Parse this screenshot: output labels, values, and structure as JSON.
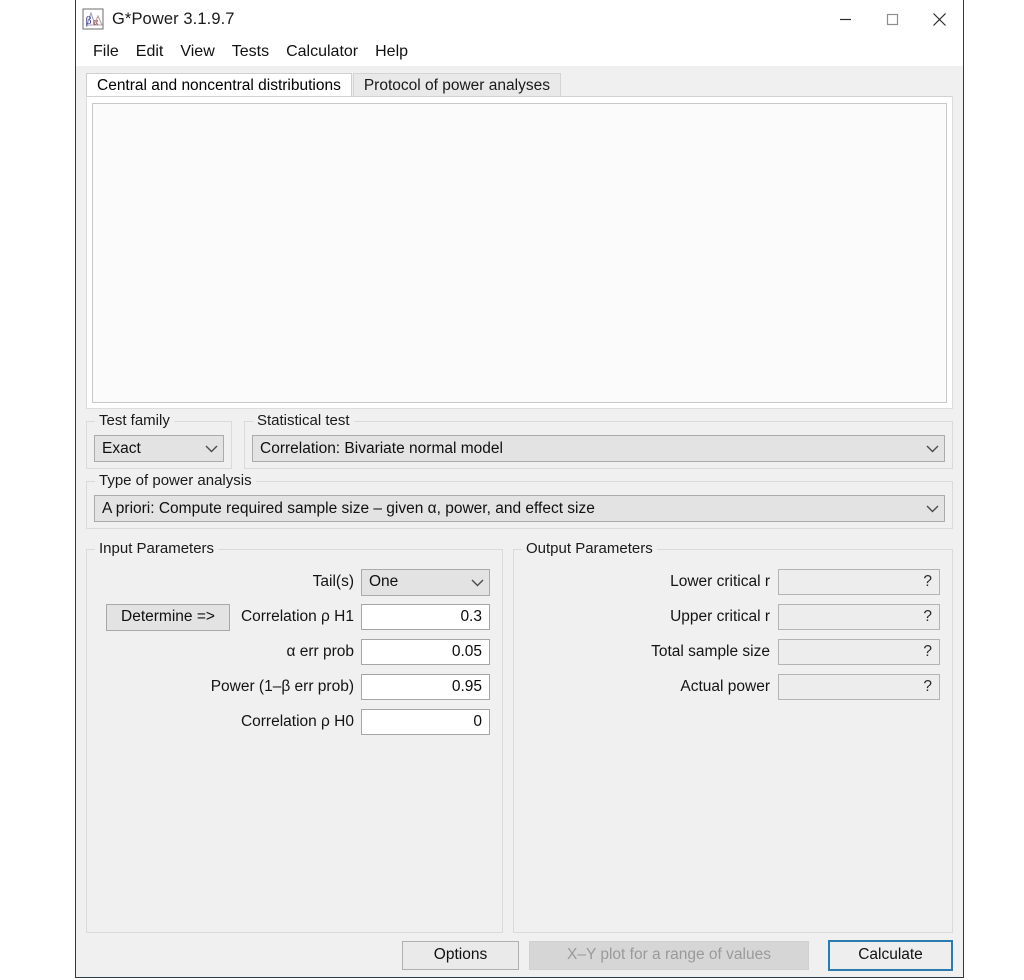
{
  "window": {
    "title": "G*Power 3.1.9.7",
    "icon": "gpower-beta-alpha-icon",
    "controls": {
      "minimize": "minimize-icon",
      "maximize": "maximize-icon",
      "close": "close-icon"
    }
  },
  "menu": {
    "items": [
      "File",
      "Edit",
      "View",
      "Tests",
      "Calculator",
      "Help"
    ]
  },
  "tabs": [
    {
      "label": "Central and noncentral distributions",
      "active": true
    },
    {
      "label": "Protocol of power analyses",
      "active": false
    }
  ],
  "test_family": {
    "title": "Test family",
    "value": "Exact"
  },
  "statistical_test": {
    "title": "Statistical test",
    "value": "Correlation: Bivariate normal model"
  },
  "power_analysis": {
    "title": "Type of power analysis",
    "value": "A priori: Compute required sample size – given α, power, and effect size"
  },
  "input_parameters": {
    "title": "Input Parameters",
    "determine_label": "Determine =>",
    "rows": [
      {
        "label": "Tail(s)",
        "value": "One",
        "type": "combo"
      },
      {
        "label": "Correlation ρ H1",
        "value": "0.3",
        "type": "text"
      },
      {
        "label": "α err prob",
        "value": "0.05",
        "type": "text"
      },
      {
        "label": "Power (1–β err prob)",
        "value": "0.95",
        "type": "text"
      },
      {
        "label": "Correlation ρ H0",
        "value": "0",
        "type": "text"
      }
    ]
  },
  "output_parameters": {
    "title": "Output Parameters",
    "rows": [
      {
        "label": "Lower critical r",
        "value": "?"
      },
      {
        "label": "Upper critical r",
        "value": "?"
      },
      {
        "label": "Total sample size",
        "value": "?"
      },
      {
        "label": "Actual power",
        "value": "?"
      }
    ]
  },
  "buttons": {
    "options": "Options",
    "xy_plot": "X–Y plot for a range of values",
    "calculate": "Calculate"
  },
  "colors": {
    "focus_blue": "#2a7cb0",
    "window_bg": "#f0f0f0",
    "field_bg": "#ffffff",
    "combo_bg": "#e3e3e3",
    "disabled_text": "#9a9a9a"
  }
}
